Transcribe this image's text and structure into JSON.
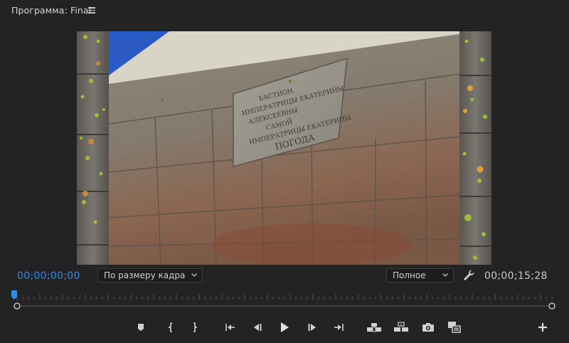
{
  "panel": {
    "title": "Программа: Final",
    "menu_icon": "hamburger-icon"
  },
  "viewer": {
    "content": "image of an old granite embankment wall with a memorial plaque, framed by wooden planks with autumn leaves",
    "plaque_lines": [
      "БАСТИОН",
      "ИМПЕРАТРИЦЫ ЕКАТЕРИНЫ",
      "АЛЕКСЕЕВНЫ",
      "САМОЙ",
      "ИМПЕРАТРИЦЫ ЕКАТЕРИНЫ",
      "ПОГОДА"
    ]
  },
  "controls": {
    "current_timecode": "00;00;00;00",
    "zoom_select": "По размеру кадра",
    "quality_select": "Полное",
    "duration_timecode": "00;00;15;28",
    "colors": {
      "current_timecode": "#2d8ceb",
      "playhead": "#2d8ceb"
    }
  },
  "transport": {
    "buttons": [
      {
        "name": "add-marker-button",
        "icon": "marker-icon"
      },
      {
        "name": "mark-in-button",
        "icon": "mark-in-icon"
      },
      {
        "name": "mark-out-button",
        "icon": "mark-out-icon"
      },
      {
        "name": "go-to-in-button",
        "icon": "go-to-in-icon"
      },
      {
        "name": "step-back-button",
        "icon": "step-back-icon"
      },
      {
        "name": "play-button",
        "icon": "play-icon"
      },
      {
        "name": "step-forward-button",
        "icon": "step-forward-icon"
      },
      {
        "name": "go-to-out-button",
        "icon": "go-to-out-icon"
      },
      {
        "name": "lift-button",
        "icon": "lift-icon"
      },
      {
        "name": "extract-button",
        "icon": "extract-icon"
      },
      {
        "name": "export-frame-button",
        "icon": "camera-icon"
      },
      {
        "name": "comparison-view-button",
        "icon": "comparison-icon"
      },
      {
        "name": "button-editor",
        "icon": "plus-icon"
      }
    ]
  }
}
